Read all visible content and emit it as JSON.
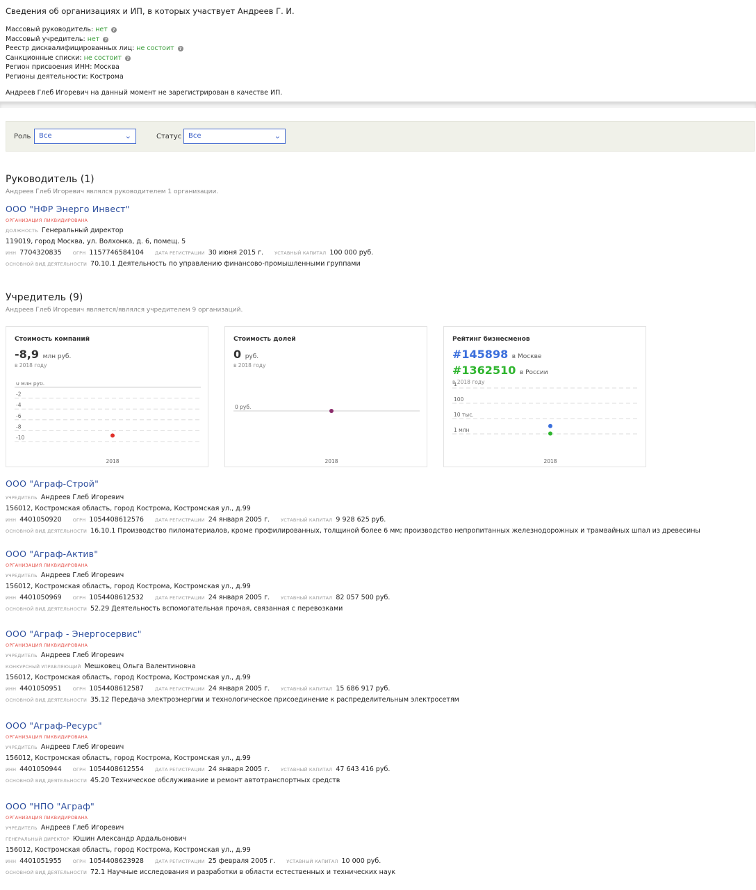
{
  "header": {
    "title": "Сведения об организациях и ИП, в которых участвует Андреев Г. И.",
    "facts": [
      {
        "label": "Массовый руководитель: ",
        "value": "нет",
        "help": true
      },
      {
        "label": "Массовый учредитель: ",
        "value": "нет",
        "help": true
      },
      {
        "label": "Реестр дисквалифицированных лиц: ",
        "value": "не состоит",
        "help": true
      },
      {
        "label": "Санкционные списки: ",
        "value": "не состоит",
        "help": true
      },
      {
        "label": "Регион присвоения ИНН: Москва",
        "value": "",
        "help": false
      },
      {
        "label": "Регионы деятельности: Кострома",
        "value": "",
        "help": false
      }
    ],
    "ip_note": "Андреев Глеб Игоревич на данный момент не зарегистрирован в качестве ИП."
  },
  "filters": {
    "role_label": "Роль",
    "role_value": "Все",
    "status_label": "Статус",
    "status_value": "Все"
  },
  "labels": {
    "inn": "ИНН",
    "ogrn": "ОГРН",
    "reg_date": "ДАТА РЕГИСТРАЦИИ",
    "capital": "УСТАВНЫЙ КАПИТАЛ",
    "activity": "ОСНОВНОЙ ВИД ДЕЯТЕЛЬНОСТИ",
    "position": "ДОЛЖНОСТЬ",
    "founder": "УЧРЕДИТЕЛЬ",
    "liquidated": "ОРГАНИЗАЦИЯ ЛИКВИДИРОВАНА"
  },
  "manager_section": {
    "title": "Руководитель (1)",
    "subtitle": "Андреев Глеб Игоревич являлся руководителем 1 организации.",
    "org": {
      "name": "ООО \"НФР Энерго Инвест\"",
      "position": "Генеральный директор",
      "address": "119019, город Москва, ул. Волхонка, д. 6, помещ. 5",
      "inn": "7704320835",
      "ogrn": "1157746584104",
      "reg_date": "30 июня 2015 г.",
      "capital": "100 000 руб.",
      "activity": "70.10.1 Деятельность по управлению финансово-промышленными группами"
    }
  },
  "founder_section": {
    "title": "Учредитель (9)",
    "subtitle": "Андреев Глеб Игоревич является/являлся учредителем 9 организаций."
  },
  "cards": {
    "companies": {
      "title": "Стоимость компаний",
      "value": "-8,9",
      "unit": "млн руб.",
      "year_note": "в 2018 году",
      "ticks": [
        "0 млн руб.",
        "-2",
        "-4",
        "-6",
        "-8",
        "-10"
      ],
      "x_label": "2018"
    },
    "shares": {
      "title": "Стоимость долей",
      "value": "0",
      "unit": "руб.",
      "year_note": "в 2018 году",
      "ticks": [
        "0 руб."
      ],
      "x_label": "2018"
    },
    "rating": {
      "title": "Рейтинг бизнесменов",
      "moscow": "#145898",
      "moscow_label": "в Москве",
      "russia": "#1362510",
      "russia_label": "в России",
      "year_note": "в 2018 году",
      "ticks": [
        "1",
        "100",
        "10 тыс.",
        "1 млн"
      ],
      "x_label": "2018"
    }
  },
  "chart_data": [
    {
      "type": "scatter",
      "title": "Стоимость компаний",
      "x": [
        "2018"
      ],
      "y": [
        -8.9
      ],
      "ylim": [
        -10,
        0
      ],
      "yticks": [
        "0 млн руб.",
        "-2",
        "-4",
        "-6",
        "-8",
        "-10"
      ],
      "color": "#e0302a"
    },
    {
      "type": "scatter",
      "title": "Стоимость долей",
      "x": [
        "2018"
      ],
      "y": [
        0
      ],
      "yticks": [
        "0 руб."
      ],
      "color": "#8b2c6b"
    },
    {
      "type": "scatter",
      "title": "Рейтинг бизнесменов",
      "x": [
        "2018"
      ],
      "log_scale": true,
      "yticks": [
        "1",
        "100",
        "10 тыс.",
        "1 млн"
      ],
      "series": [
        {
          "name": "в Москве",
          "values": [
            145898
          ],
          "color": "#3b6fdc"
        },
        {
          "name": "в России",
          "values": [
            1362510
          ],
          "color": "#2fb52f"
        }
      ]
    }
  ],
  "founder_orgs": [
    {
      "name": "ООО \"Аграф-Строй\"",
      "liquidated": false,
      "people": [
        {
          "role": "УЧРЕДИТЕЛЬ",
          "name": "Андреев Глеб Игоревич"
        }
      ],
      "address": "156012, Костромская область, город Кострома, Костромская ул., д.99",
      "inn": "4401050920",
      "ogrn": "1054408612576",
      "reg_date": "24 января 2005 г.",
      "capital": "9 928 625 руб.",
      "activity": "16.10.1 Производство пиломатериалов, кроме профилированных, толщиной более 6 мм; производство непропитанных железнодорожных и трамвайных шпал из древесины"
    },
    {
      "name": "ООО \"Аграф-Актив\"",
      "liquidated": true,
      "people": [
        {
          "role": "УЧРЕДИТЕЛЬ",
          "name": "Андреев Глеб Игоревич"
        }
      ],
      "address": "156012, Костромская область, город Кострома, Костромская ул., д.99",
      "inn": "4401050969",
      "ogrn": "1054408612532",
      "reg_date": "24 января 2005 г.",
      "capital": "82 057 500 руб.",
      "activity": "52.29 Деятельность вспомогательная прочая, связанная с перевозками"
    },
    {
      "name": "ООО \"Аграф - Энергосервис\"",
      "liquidated": true,
      "people": [
        {
          "role": "УЧРЕДИТЕЛЬ",
          "name": "Андреев Глеб Игоревич"
        },
        {
          "role": "КОНКУРСНЫЙ УПРАВЛЯЮЩИЙ",
          "name": "Мешковец Ольга Валентиновна"
        }
      ],
      "address": "156012, Костромская область, город Кострома, Костромская ул., д.99",
      "inn": "4401050951",
      "ogrn": "1054408612587",
      "reg_date": "24 января 2005 г.",
      "capital": "15 686 917 руб.",
      "activity": "35.12 Передача электроэнергии и технологическое присоединение к распределительным электросетям"
    },
    {
      "name": "ООО \"Аграф-Ресурс\"",
      "liquidated": true,
      "people": [
        {
          "role": "УЧРЕДИТЕЛЬ",
          "name": "Андреев Глеб Игоревич"
        }
      ],
      "address": "156012, Костромская область, город Кострома, Костромская ул., д.99",
      "inn": "4401050944",
      "ogrn": "1054408612554",
      "reg_date": "24 января 2005 г.",
      "capital": "47 643 416 руб.",
      "activity": "45.20 Техническое обслуживание и ремонт автотранспортных средств"
    },
    {
      "name": "ООО \"НПО \"Аграф\"",
      "liquidated": true,
      "people": [
        {
          "role": "УЧРЕДИТЕЛЬ",
          "name": "Андреев Глеб Игоревич"
        },
        {
          "role": "ГЕНЕРАЛЬНЫЙ ДИРЕКТОР",
          "name": "Юшин Александр Ардальонович"
        }
      ],
      "address": "156012, Костромская область, город Кострома, Костромская ул., д.99",
      "inn": "4401051955",
      "ogrn": "1054408623928",
      "reg_date": "25 февраля 2005 г.",
      "capital": "10 000 руб.",
      "activity": "72.1 Научные исследования и разработки в области естественных и технических наук"
    }
  ]
}
